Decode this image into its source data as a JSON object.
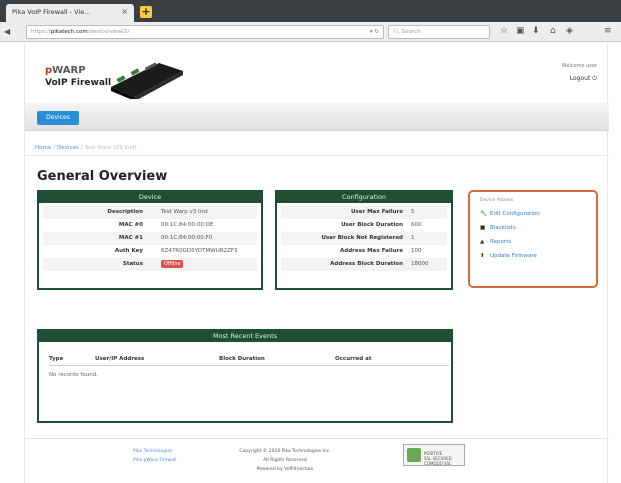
{
  "browser": {
    "tab_title": "Pika VoIP Firewall - Vie...",
    "tab_close": "×",
    "new_tab": "+",
    "url_prefix": "https://",
    "url_domain": "pikatech.com",
    "url_suffix": "/device/view/2/",
    "search_placeholder": "Search"
  },
  "header": {
    "logo_line1_prefix": "p",
    "logo_line1": "WARP",
    "logo_line2": "VoIP Firewall",
    "welcome": "Welcome user",
    "logout": "Logout"
  },
  "nav": {
    "devices_button": "Devices"
  },
  "breadcrumb": {
    "home": "Home",
    "devices": "Devices",
    "current": "Test Warp (V3 Inst)"
  },
  "page_title": "General Overview",
  "device_panel": {
    "title": "Device",
    "rows": [
      {
        "key": "Description",
        "value": "Test Warp v3 Inst"
      },
      {
        "key": "MAC #0",
        "value": "00:1C:84:00:00:DE"
      },
      {
        "key": "MAC #1",
        "value": "00:1C:84:00:00:F0"
      },
      {
        "key": "Auth Key",
        "value": "6Z47R0GDSYDTMWUR2ZF3"
      },
      {
        "key": "Status",
        "value": "Offline"
      }
    ]
  },
  "config_panel": {
    "title": "Configuration",
    "rows": [
      {
        "key": "User Max Failure",
        "value": "5"
      },
      {
        "key": "User Block Duration",
        "value": "600"
      },
      {
        "key": "User Block Not Registered",
        "value": "1"
      },
      {
        "key": "Address Max Failure",
        "value": "100"
      },
      {
        "key": "Address Block Duration",
        "value": "18000"
      }
    ]
  },
  "actions": {
    "label": "Device Actions",
    "items": [
      {
        "icon": "wrench-icon",
        "glyph": "🔧",
        "label": "Edit Configuration"
      },
      {
        "icon": "blacklist-icon",
        "glyph": "■",
        "label": "Blacklists"
      },
      {
        "icon": "reports-icon",
        "glyph": "▲",
        "label": "Reports"
      },
      {
        "icon": "upload-icon",
        "glyph": "⬆",
        "label": "Update Firmware"
      }
    ]
  },
  "events": {
    "title": "Most Recent Events",
    "columns": [
      "Type",
      "User/IP Address",
      "Block Duration",
      "Occurred at"
    ],
    "empty": "No records found."
  },
  "footer": {
    "left_1": "Pika Technologies",
    "left_2": "Pika pWarp Firewall",
    "center_1": "Copyright © 2016 Pika Technologies Inc.",
    "center_2": "All Rights Reserved",
    "center_3": "Powered by VoIPdirection",
    "badge_1": "POSITIVE",
    "badge_2": "SSL SECURED",
    "badge_3": "COMODO SSL"
  }
}
